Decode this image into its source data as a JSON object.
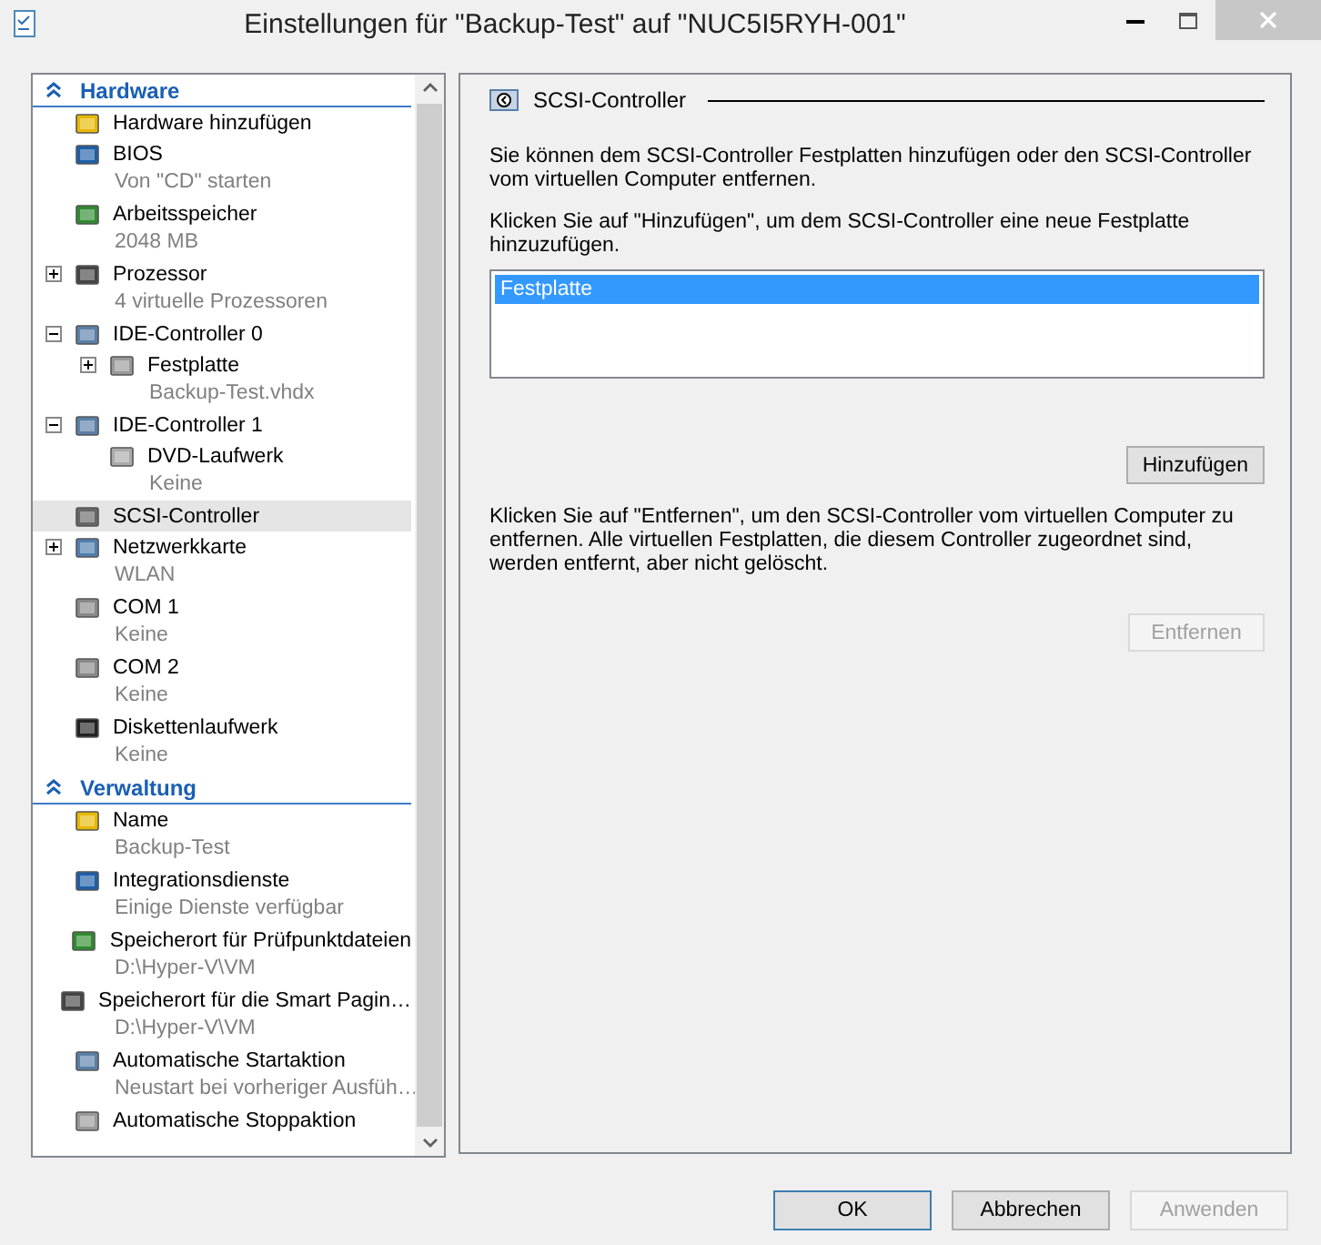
{
  "window": {
    "title": "Einstellungen für \"Backup-Test\" auf \"NUC5I5RYH-001\""
  },
  "sidebar": {
    "sections": [
      {
        "title": "Hardware",
        "expanded": true,
        "items": [
          {
            "label": "Hardware hinzufügen",
            "kind": "item",
            "selected": false
          },
          {
            "label": "BIOS",
            "detail": "Von \"CD\" starten",
            "kind": "item",
            "selected": false
          },
          {
            "label": "Arbeitsspeicher",
            "detail": "2048 MB",
            "kind": "item",
            "selected": false
          },
          {
            "label": "Prozessor",
            "detail": "4 virtuelle Prozessoren",
            "kind": "group",
            "expanded": false,
            "selected": false
          },
          {
            "label": "IDE-Controller 0",
            "kind": "group",
            "expanded": true,
            "selected": false,
            "children": [
              {
                "label": "Festplatte",
                "detail": "Backup-Test.vhdx",
                "kind": "group",
                "expanded": false,
                "selected": false
              }
            ]
          },
          {
            "label": "IDE-Controller 1",
            "kind": "group",
            "expanded": true,
            "selected": false,
            "children": [
              {
                "label": "DVD-Laufwerk",
                "detail": "Keine",
                "kind": "item",
                "selected": false
              }
            ]
          },
          {
            "label": "SCSI-Controller",
            "kind": "item",
            "selected": true
          },
          {
            "label": "Netzwerkkarte",
            "detail": "WLAN",
            "kind": "group",
            "expanded": false,
            "selected": false
          },
          {
            "label": "COM 1",
            "detail": "Keine",
            "kind": "item",
            "selected": false
          },
          {
            "label": "COM 2",
            "detail": "Keine",
            "kind": "item",
            "selected": false
          },
          {
            "label": "Diskettenlaufwerk",
            "detail": "Keine",
            "kind": "item",
            "selected": false
          }
        ]
      },
      {
        "title": "Verwaltung",
        "expanded": true,
        "items": [
          {
            "label": "Name",
            "detail": "Backup-Test",
            "kind": "item",
            "selected": false
          },
          {
            "label": "Integrationsdienste",
            "detail": "Einige Dienste verfügbar",
            "kind": "item",
            "selected": false
          },
          {
            "label": "Speicherort für Prüfpunktdateien",
            "detail": "D:\\Hyper-V\\VM",
            "kind": "item",
            "selected": false
          },
          {
            "label": "Speicherort für die Smart Pagin…",
            "detail": "D:\\Hyper-V\\VM",
            "kind": "item",
            "selected": false
          },
          {
            "label": "Automatische Startaktion",
            "detail": "Neustart bei vorheriger Ausfüh…",
            "kind": "item",
            "selected": false
          },
          {
            "label": "Automatische Stoppaktion",
            "kind": "item",
            "selected": false
          }
        ]
      }
    ]
  },
  "panel": {
    "title": "SCSI-Controller",
    "intro": "Sie können dem SCSI-Controller Festplatten hinzufügen oder den SCSI-Controller vom virtuellen Computer entfernen.",
    "add_hint": "Klicken Sie auf \"Hinzufügen\", um dem SCSI-Controller eine neue Festplatte hinzuzufügen.",
    "list": [
      {
        "label": "Festplatte",
        "selected": true
      }
    ],
    "add_button": {
      "label": "Hinzufügen",
      "disabled": false
    },
    "remove_hint": "Klicken Sie auf \"Entfernen\", um den SCSI-Controller vom virtuellen Computer zu entfernen. Alle virtuellen Festplatten, die diesem Controller zugeordnet sind, werden entfernt, aber nicht gelöscht.",
    "remove_button": {
      "label": "Entfernen",
      "disabled": true
    }
  },
  "buttons": [
    {
      "label": "OK",
      "default": true,
      "disabled": false
    },
    {
      "label": "Abbrechen",
      "default": false,
      "disabled": false
    },
    {
      "label": "Anwenden",
      "default": false,
      "disabled": true
    }
  ]
}
